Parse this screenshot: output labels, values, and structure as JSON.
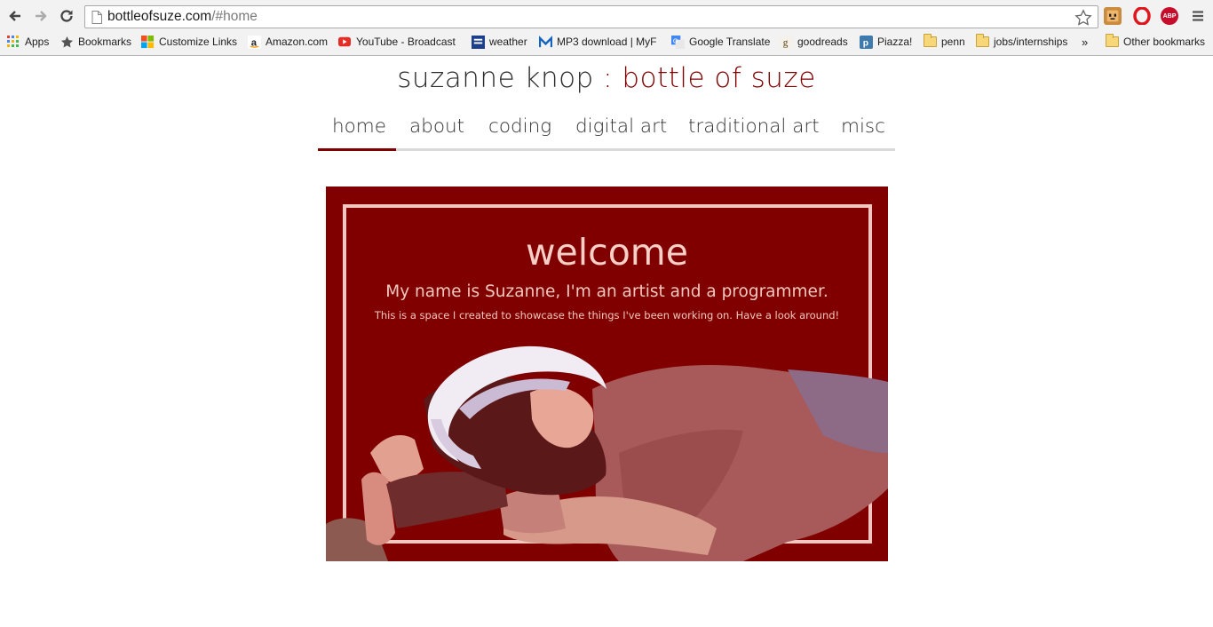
{
  "browser": {
    "url_host": "bottleofsuze.com",
    "url_path": "/#home",
    "bookmarks": [
      {
        "label": "Apps",
        "icon": "apps-grid-icon"
      },
      {
        "label": "Bookmarks",
        "icon": "star-icon"
      },
      {
        "label": "Customize Links",
        "icon": "windows-logo-icon"
      },
      {
        "label": "Amazon.com",
        "icon": "amazon-icon"
      },
      {
        "label": "YouTube - Broadcast",
        "icon": "youtube-icon"
      },
      {
        "label": "weather",
        "icon": "weather-channel-icon"
      },
      {
        "label": "MP3 download | MyF",
        "icon": "m-logo-icon"
      },
      {
        "label": "Google Translate",
        "icon": "google-translate-icon"
      },
      {
        "label": "goodreads",
        "icon": "goodreads-icon"
      },
      {
        "label": "Piazza!",
        "icon": "piazza-icon"
      },
      {
        "label": "penn",
        "icon": "folder-icon"
      },
      {
        "label": "jobs/internships",
        "icon": "folder-icon"
      }
    ],
    "overflow_label": "»",
    "other_bookmarks": "Other bookmarks",
    "ext_abp_label": "ABP",
    "colors": {
      "youtube": "#e52d27",
      "opera": "#e0161f",
      "abp": "#c70d2c"
    }
  },
  "site": {
    "title_name": "suzanne knop",
    "title_sep": " : ",
    "title_brand": "bottle of suze",
    "accent_color": "#800000",
    "nav": [
      "home",
      "about",
      "coding",
      "digital art",
      "traditional art",
      "misc"
    ],
    "active_tab": "home"
  },
  "hero": {
    "heading": "welcome",
    "tagline": "My name is Suzanne, I'm an artist and a programmer.",
    "subtext": "This is a space I created to showcase the things I've been working on. Have a look around!"
  }
}
